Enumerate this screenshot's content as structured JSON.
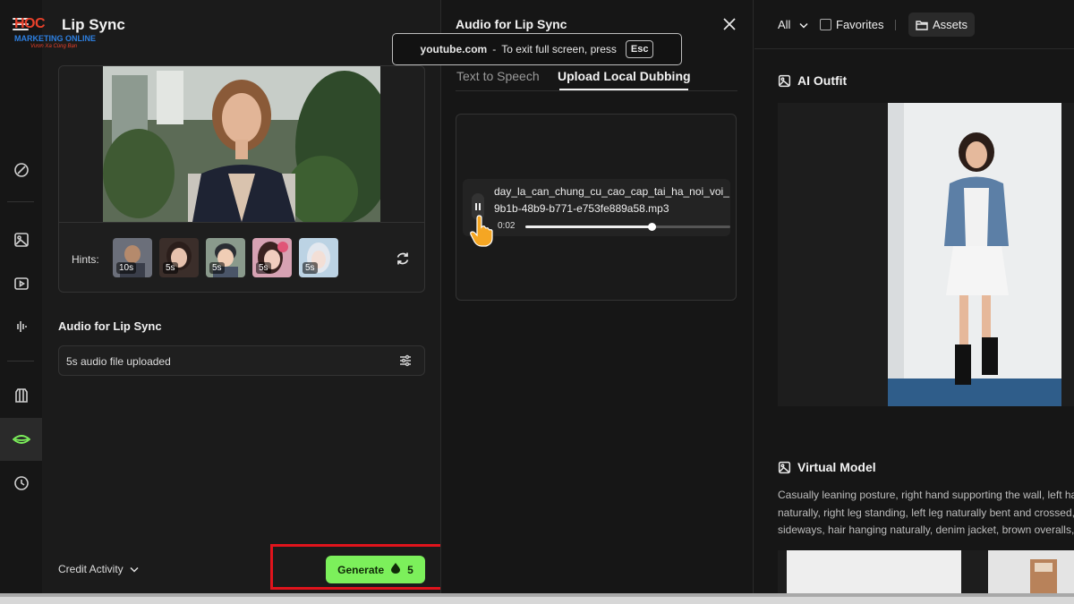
{
  "app": {
    "title": "Lip Sync"
  },
  "logo": {
    "line1": "HOC",
    "line2": "MARKETING ONLINE",
    "line3": "Vươn Xa Cùng Bạn"
  },
  "left": {
    "hints_label": "Hints:",
    "hints": [
      {
        "duration": "10s"
      },
      {
        "duration": "5s"
      },
      {
        "duration": "5s"
      },
      {
        "duration": "5s"
      },
      {
        "duration": "5s"
      }
    ],
    "audio_section_label": "Audio for Lip Sync",
    "audio_field_value": "5s audio file uploaded",
    "credit_label": "Credit Activity",
    "generate_label": "Generate",
    "generate_cost": "5"
  },
  "middle": {
    "title": "Audio for Lip Sync",
    "fullscreen": {
      "site": "youtube.com",
      "separator": "-",
      "message": "To exit full screen, press",
      "key": "Esc"
    },
    "tabs": [
      {
        "label": "Text to Speech",
        "active": false
      },
      {
        "label": "Upload Local Dubbing",
        "active": true
      }
    ],
    "player": {
      "filename_line1": "day_la_can_chung_cu_cao_cap_tai_ha_noi_voi_",
      "filename_line2": "9b1b-48b9-b771-e753fe889a58.mp3",
      "time": "0:02",
      "progress": 0.62
    }
  },
  "right": {
    "filter_all": "All",
    "favorites_label": "Favorites",
    "assets_label": "Assets",
    "sections": [
      {
        "title": "AI Outfit"
      },
      {
        "title": "Virtual Model"
      }
    ],
    "virtual_model_desc": [
      "Casually leaning posture, right hand supporting the wall, left hand",
      "naturally, right leg standing, left leg naturally bent and crossed, boc",
      "sideways, hair hanging naturally, denim jacket, brown overalls, bla"
    ]
  },
  "colors": {
    "accent": "#7cf05b",
    "highlight": "#e0141c",
    "background": "#161616"
  }
}
